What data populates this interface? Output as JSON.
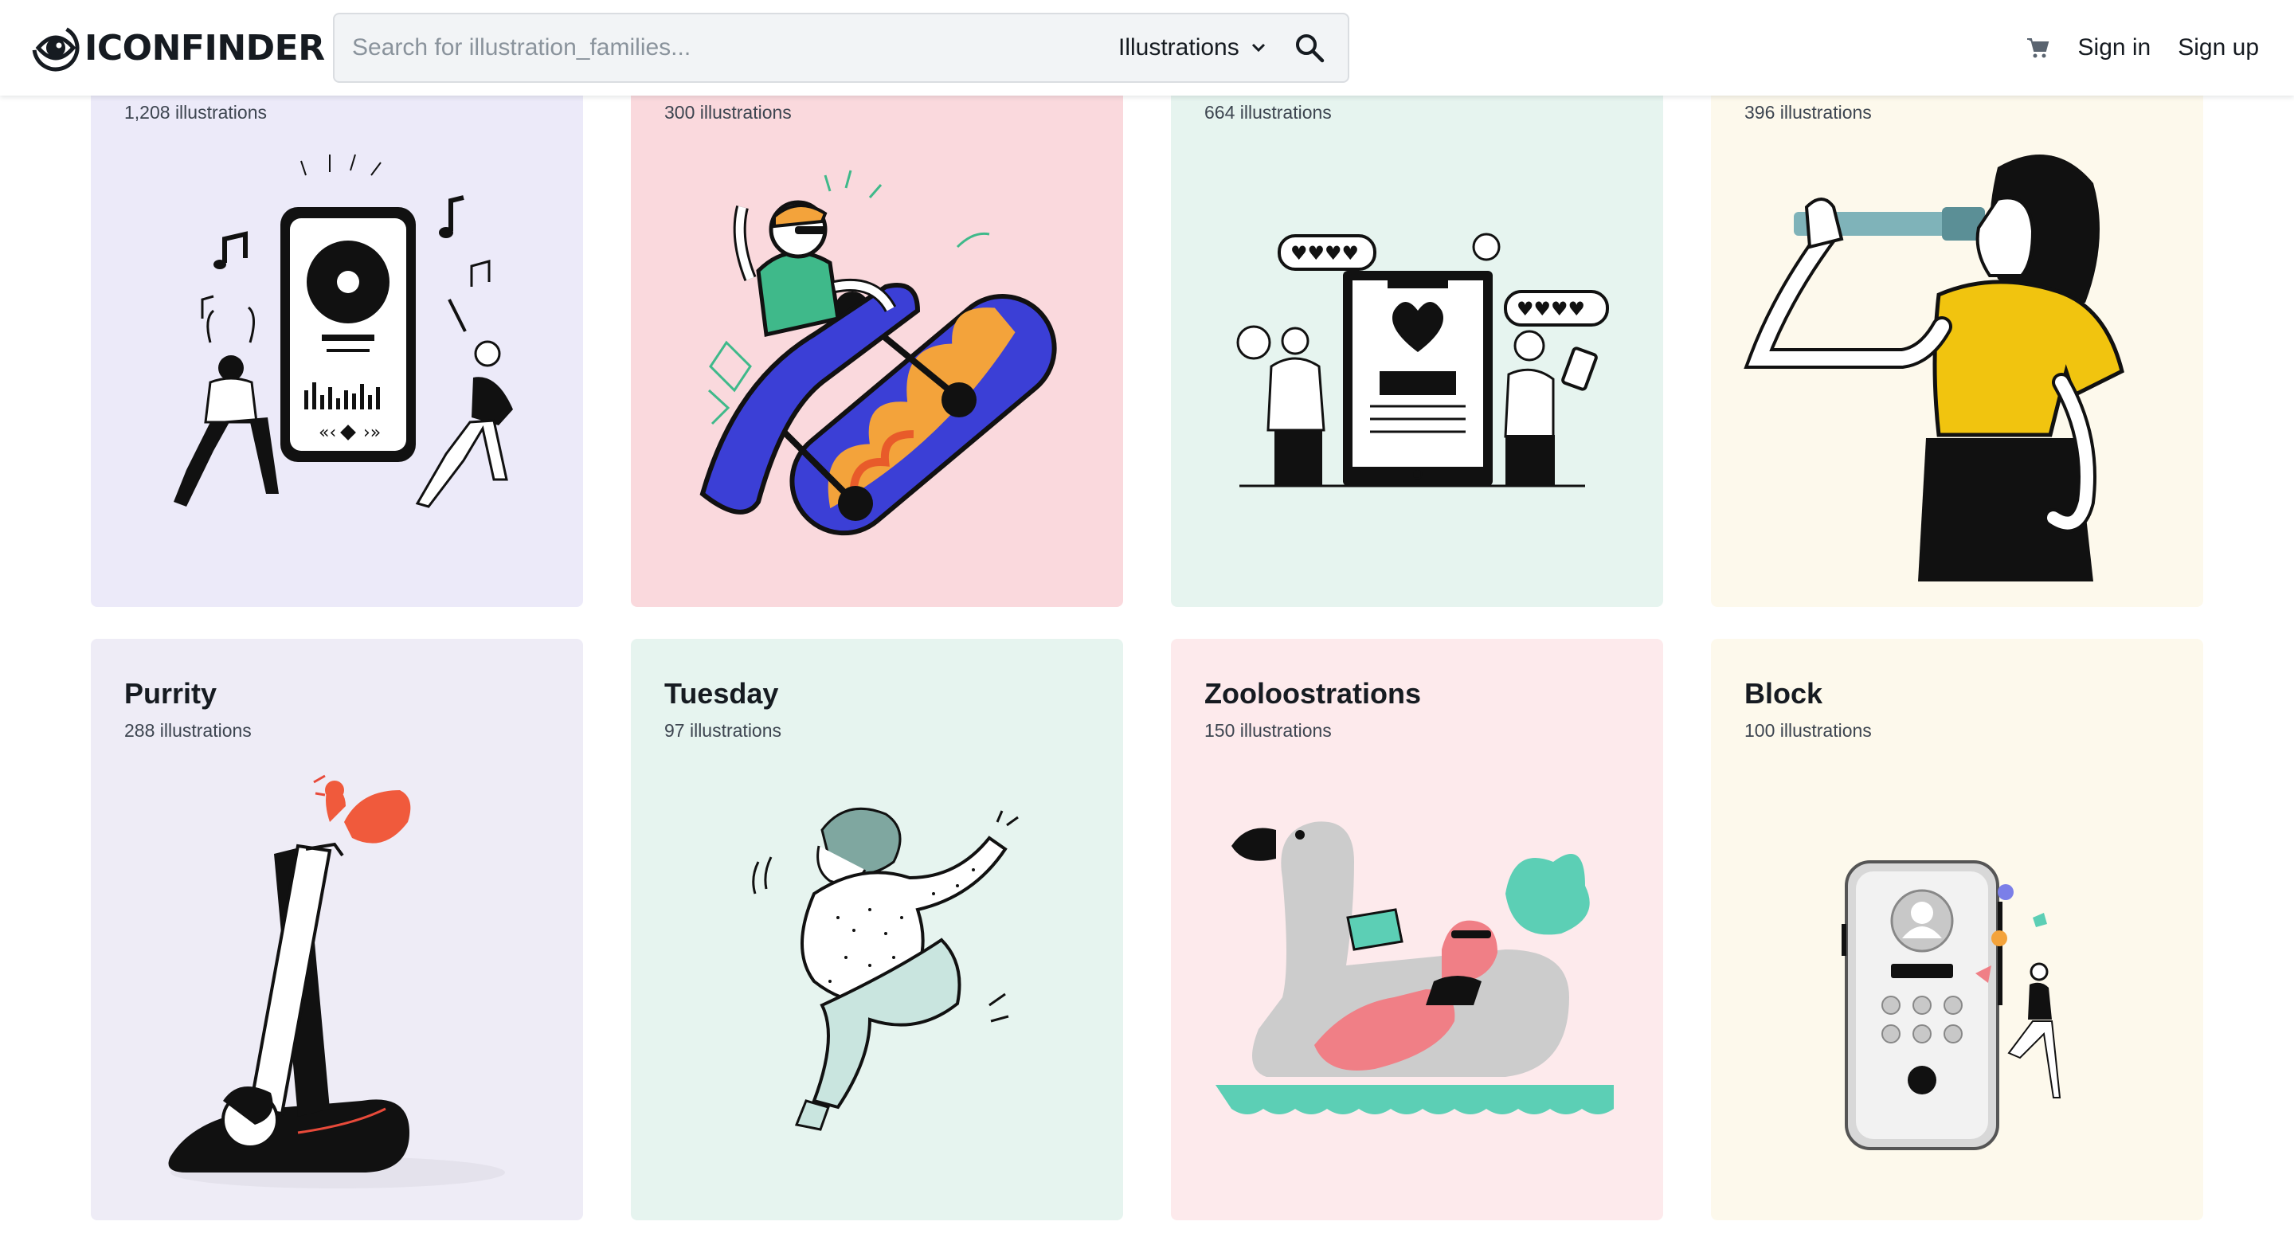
{
  "header": {
    "logo_text": "ICONFINDER",
    "search_placeholder": "Search for illustration_families...",
    "search_type": "Illustrations",
    "sign_in": "Sign in",
    "sign_up": "Sign up"
  },
  "cards": [
    {
      "title": "",
      "count": "1,208 illustrations",
      "bg": "#eceaf9"
    },
    {
      "title": "",
      "count": "300 illustrations",
      "bg": "#fad9dd"
    },
    {
      "title": "",
      "count": "664 illustrations",
      "bg": "#e6f4ef"
    },
    {
      "title": "",
      "count": "396 illustrations",
      "bg": "#fdf9ec"
    },
    {
      "title": "Purrity",
      "count": "288 illustrations",
      "bg": "#eeecf6"
    },
    {
      "title": "Tuesday",
      "count": "97 illustrations",
      "bg": "#e6f4ef"
    },
    {
      "title": "Zooloostrations",
      "count": "150 illustrations",
      "bg": "#fdeaec"
    },
    {
      "title": "Block",
      "count": "100 illustrations",
      "bg": "#fdf9ec"
    }
  ]
}
